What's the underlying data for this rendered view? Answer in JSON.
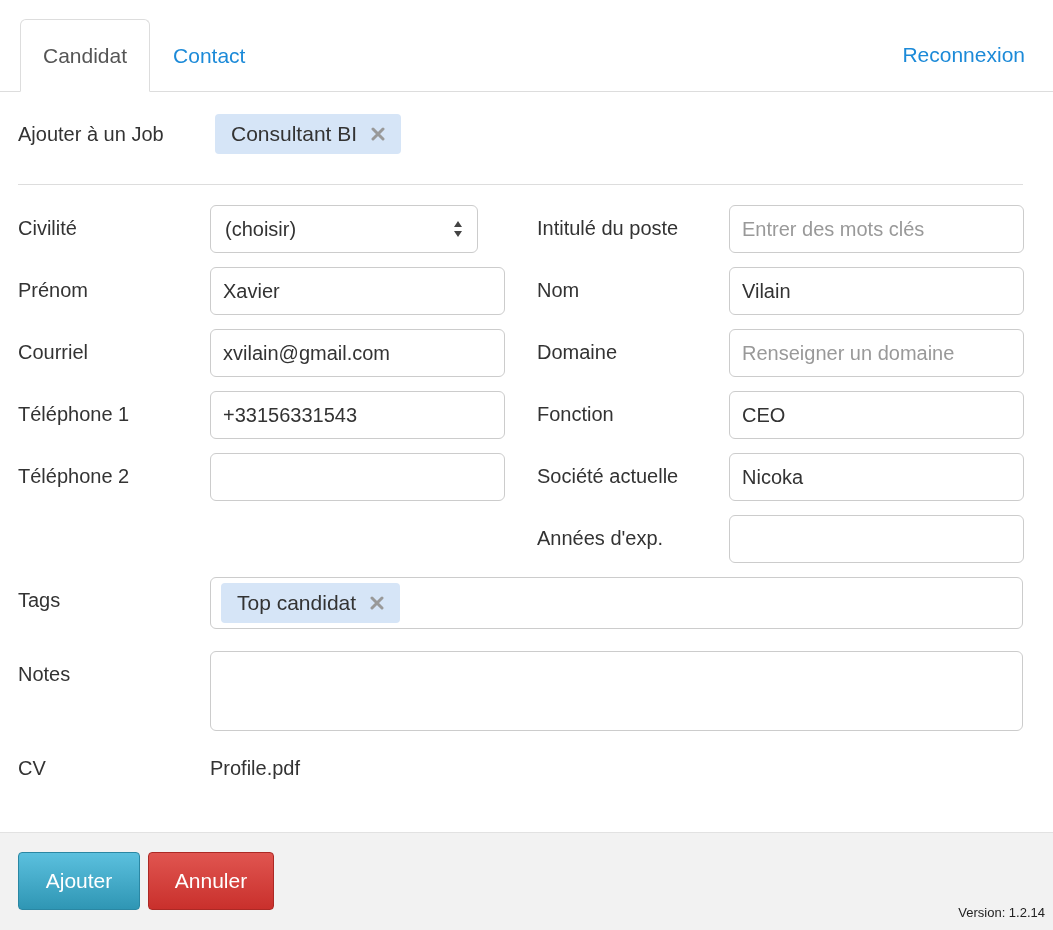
{
  "tabs": [
    {
      "label": "Candidat",
      "selected": true
    },
    {
      "label": "Contact",
      "selected": false
    }
  ],
  "reconnect_link": "Reconnexion",
  "job": {
    "label": "Ajouter à un Job",
    "tags": [
      "Consultant BI"
    ]
  },
  "left_fields": [
    {
      "label": "Civilité",
      "kind": "select",
      "value": "(choisir)"
    },
    {
      "label": "Prénom",
      "kind": "text",
      "value": "Xavier"
    },
    {
      "label": "Courriel",
      "kind": "text",
      "value": "xvilain@gmail.com"
    },
    {
      "label": "Téléphone 1",
      "kind": "text",
      "value": "+33156331543"
    },
    {
      "label": "Téléphone 2",
      "kind": "text"
    }
  ],
  "right_fields": [
    {
      "label": "Intitulé du poste",
      "kind": "text",
      "placeholder": "Entrer des mots clés"
    },
    {
      "label": "Nom",
      "kind": "text",
      "value": "Vilain"
    },
    {
      "label": "Domaine",
      "kind": "text",
      "placeholder": "Renseigner un domaine"
    },
    {
      "label": "Fonction",
      "kind": "text",
      "value": "CEO"
    },
    {
      "label": "Société actuelle",
      "kind": "text",
      "value": "Nicoka"
    },
    {
      "label": "Années d'exp.",
      "kind": "text"
    }
  ],
  "tags": {
    "label": "Tags",
    "items": [
      "Top candidat"
    ]
  },
  "notes": {
    "label": "Notes"
  },
  "cv": {
    "label": "CV",
    "file": "Profile.pdf"
  },
  "buttons": [
    {
      "label": "Ajouter",
      "kind": "primary"
    },
    {
      "label": "Annuler",
      "kind": "danger"
    }
  ],
  "version": "Version: 1.2.14"
}
